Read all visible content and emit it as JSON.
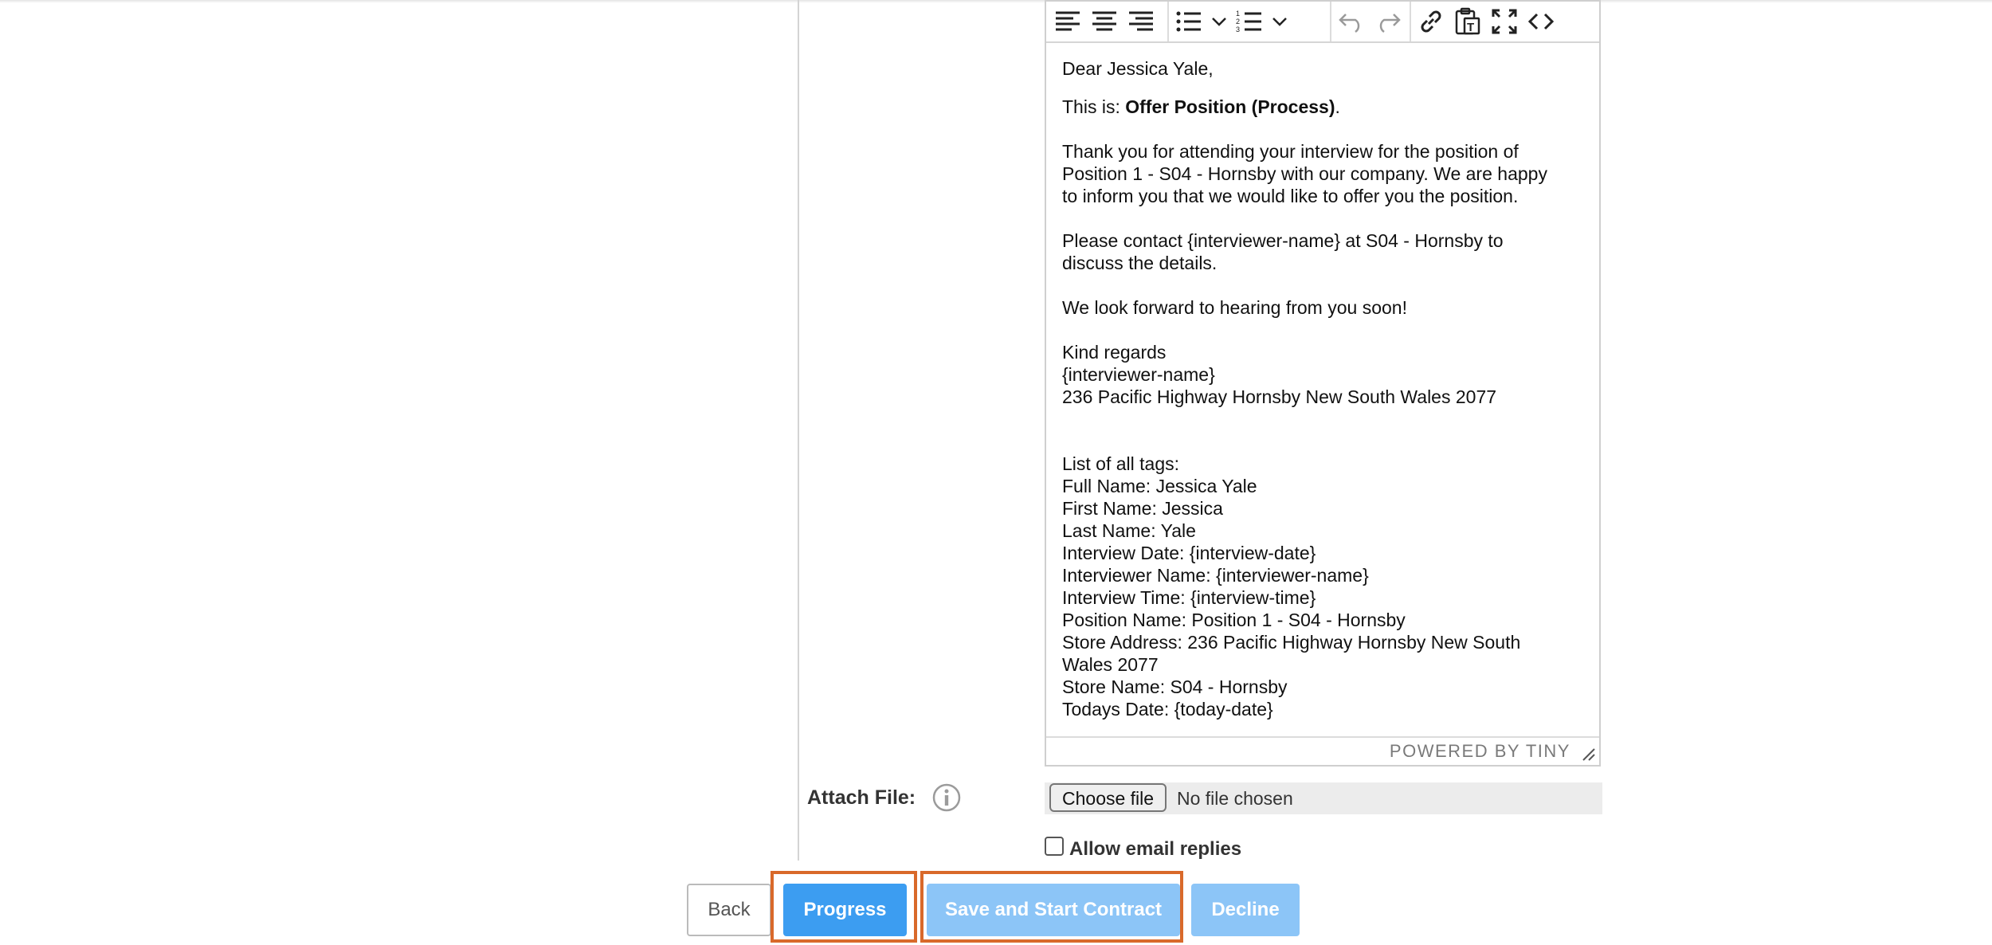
{
  "editor": {
    "content": {
      "greeting": "Dear Jessica Yale,",
      "this_is_prefix": "This is: ",
      "this_is_bold": "Offer Position (Process)",
      "this_is_suffix": ".",
      "para1_line1": "Thank you for attending your interview for the position of",
      "para1_line2": "Position 1 - S04 - Hornsby with our company. We are happy",
      "para1_line3": "to inform you that we would like to offer you the position.",
      "para2_line1": "Please contact {interviewer-name} at S04 - Hornsby to",
      "para2_line2": "discuss the details.",
      "para3": "We look forward to hearing from you soon!",
      "sign1": "Kind regards",
      "sign2": "{interviewer-name}",
      "sign3": "236 Pacific Highway Hornsby New South Wales 2077",
      "tags_header": "List of all tags:",
      "tags": [
        "Full Name: Jessica Yale",
        "First Name: Jessica",
        "Last Name: Yale",
        "Interview Date: {interview-date}",
        "Interviewer Name: {interviewer-name}",
        "Interview Time: {interview-time}",
        "Position Name: Position 1 - S04 - Hornsby",
        "Store Address: 236 Pacific Highway Hornsby New South",
        "Wales 2077",
        "Store Name: S04 - Hornsby",
        "Todays Date: {today-date}"
      ]
    },
    "powered_by": "POWERED BY TINY"
  },
  "attach": {
    "label": "Attach File:",
    "choose_button": "Choose file",
    "status": "No file chosen"
  },
  "allow_replies_label": "Allow email replies",
  "buttons": {
    "back": "Back",
    "progress": "Progress",
    "save_start": "Save and Start Contract",
    "decline": "Decline"
  },
  "colors": {
    "primary": "#3c9df1",
    "primary_disabled": "#8cc5f7",
    "highlight": "#d9692a"
  }
}
